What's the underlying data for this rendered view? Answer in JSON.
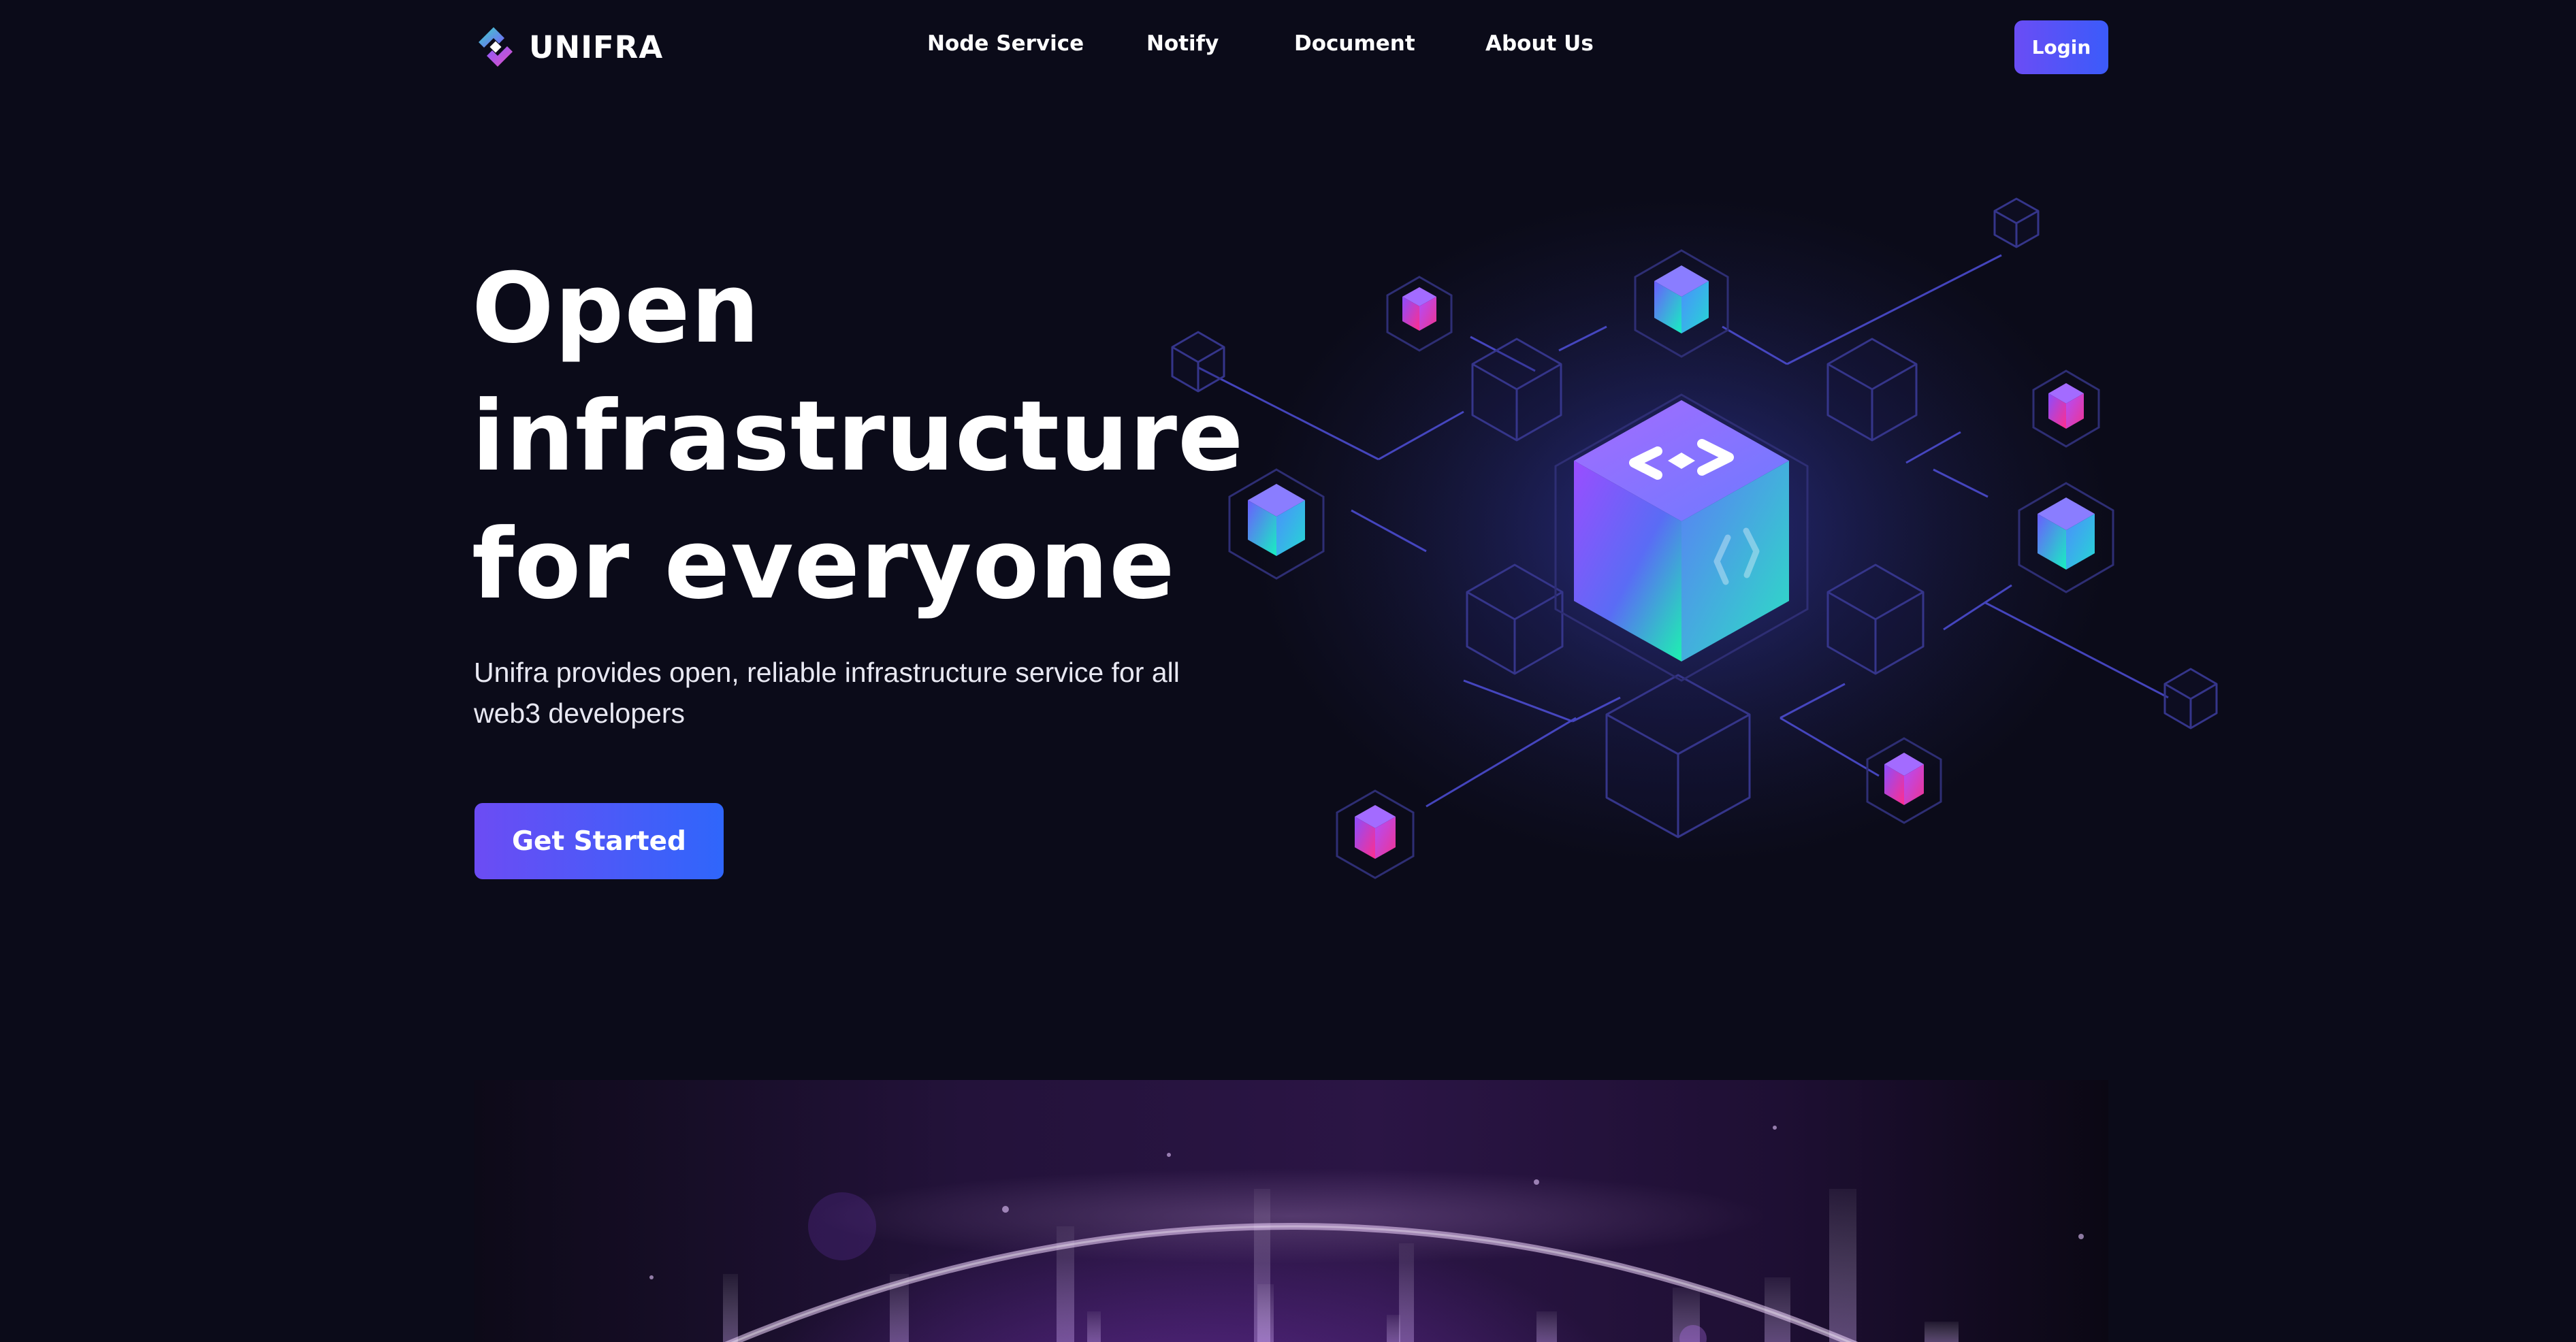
{
  "brand": {
    "name": "UNIFRA",
    "logo_icon": "unifra-diamond-logo-icon"
  },
  "nav": {
    "items": [
      {
        "label": "Node Service"
      },
      {
        "label": "Notify"
      },
      {
        "label": "Document"
      },
      {
        "label": "About Us"
      }
    ],
    "login_label": "Login"
  },
  "hero": {
    "title_lines": [
      "Open",
      "infrastructure",
      "for everyone"
    ],
    "subtitle_lines": [
      "Unifra provides open, reliable infrastructure service for all",
      "web3 developers"
    ],
    "cta_label": "Get Started",
    "illustration_icon": "blockchain-network-cube-icon"
  },
  "banner": {
    "illustration_icon": "glowing-planet-horizon-icon"
  },
  "colors": {
    "background": "#0b0b19",
    "accent_purple": "#6c4cf4",
    "accent_blue": "#2f66fb",
    "cube_teal": "#1de9b6",
    "cube_magenta": "#e0338f"
  }
}
